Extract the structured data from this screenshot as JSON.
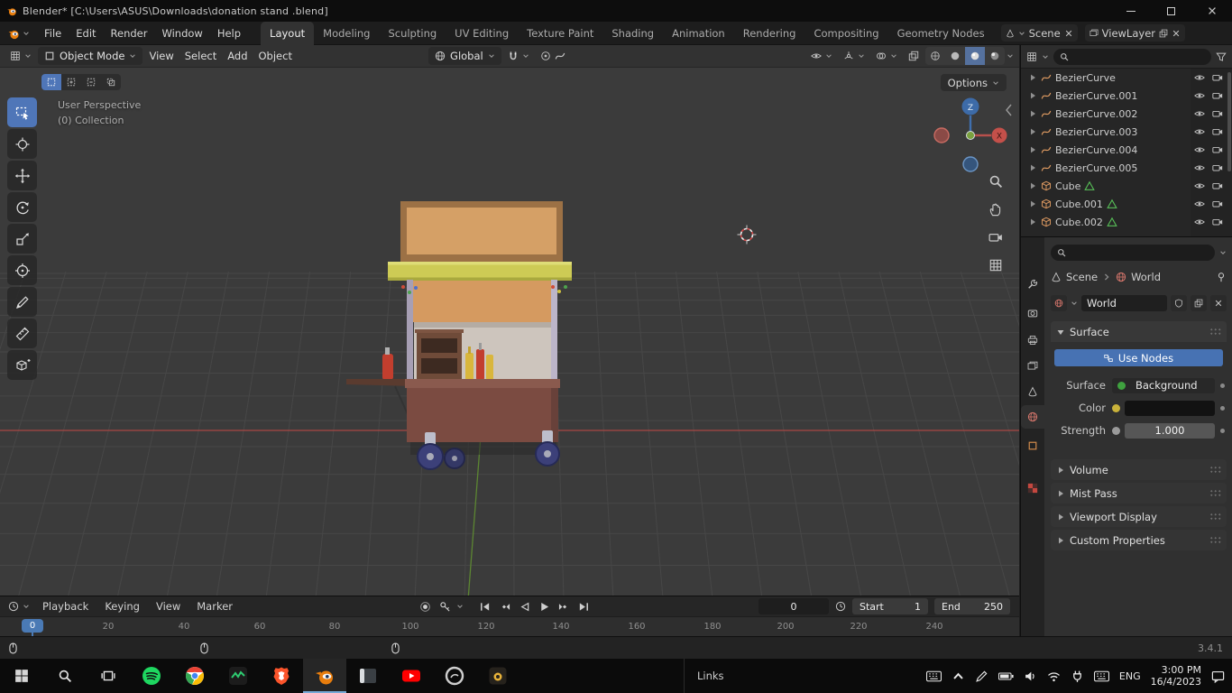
{
  "colors": {
    "accent": "#4772b3",
    "active_tool": "#4f76b8",
    "axis_x": "#b8504c",
    "axis_y": "#5c8632",
    "viewport_bg": "#3b3b3b",
    "world_color": "#121212"
  },
  "titlebar": {
    "title": "Blender* [C:\\Users\\ASUS\\Downloads\\donation stand .blend]"
  },
  "menubar": {
    "menus": [
      "File",
      "Edit",
      "Render",
      "Window",
      "Help"
    ],
    "workspaces": [
      "Layout",
      "Modeling",
      "Sculpting",
      "UV Editing",
      "Texture Paint",
      "Shading",
      "Animation",
      "Rendering",
      "Compositing",
      "Geometry Nodes"
    ],
    "scene": "Scene",
    "viewlayer": "ViewLayer"
  },
  "viewport": {
    "mode": "Object Mode",
    "menus": [
      "View",
      "Select",
      "Add",
      "Object"
    ],
    "orientation": "Global",
    "options": "Options",
    "perspective": "User Perspective",
    "collection": "(0) Collection",
    "gizmo": {
      "x": "X",
      "z": "Z"
    }
  },
  "outliner": {
    "items": [
      "BezierCurve",
      "BezierCurve.001",
      "BezierCurve.002",
      "BezierCurve.003",
      "BezierCurve.004",
      "BezierCurve.005",
      "Cube",
      "Cube.001",
      "Cube.002"
    ]
  },
  "properties": {
    "path_scene": "Scene",
    "path_world": "World",
    "datablock": "World",
    "surface": {
      "title": "Surface",
      "use_nodes": "Use Nodes",
      "surface_label": "Surface",
      "surface_value": "Background",
      "color_label": "Color",
      "strength_label": "Strength",
      "strength_value": "1.000"
    },
    "panels": [
      "Volume",
      "Mist Pass",
      "Viewport Display",
      "Custom Properties"
    ]
  },
  "timeline": {
    "menus": [
      "Playback",
      "Keying",
      "View",
      "Marker"
    ],
    "current_frame": "0",
    "playhead": "0",
    "start_label": "Start",
    "start_value": "1",
    "end_label": "End",
    "end_value": "250",
    "ticks": [
      "0",
      "20",
      "40",
      "60",
      "80",
      "100",
      "120",
      "140",
      "160",
      "180",
      "200",
      "220",
      "240"
    ]
  },
  "statusbar": {
    "version": "3.4.1"
  },
  "taskbar": {
    "links": "Links",
    "lang": "ENG",
    "time": "3:00 PM",
    "date": "16/4/2023"
  }
}
